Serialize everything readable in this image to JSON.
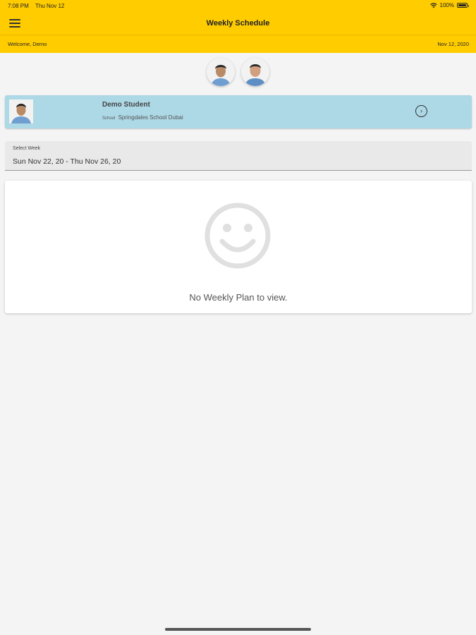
{
  "status_bar": {
    "time": "7:08 PM",
    "date": "Thu Nov 12",
    "battery": "100%"
  },
  "header": {
    "title": "Weekly Schedule",
    "welcome": "Welcome, Demo",
    "date": "Nov 12, 2020",
    "background_color": "#ffcc00"
  },
  "avatars": [
    {
      "name": "student-avatar"
    },
    {
      "name": "parent-avatar"
    }
  ],
  "student": {
    "name": "Demo Student",
    "school_label": "School",
    "school": "Springdales School Dubai",
    "card_color": "#add8e6"
  },
  "week": {
    "label": "Select Week",
    "value": "Sun Nov 22, 20 - Thu Nov 26, 20"
  },
  "empty_state": {
    "icon": "smiley-icon",
    "message": "No Weekly Plan to view."
  }
}
